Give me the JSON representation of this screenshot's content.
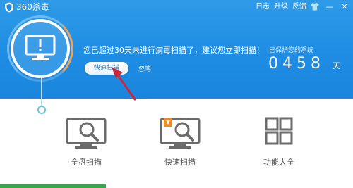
{
  "app": {
    "title": "360杀毒"
  },
  "top_links": [
    "日志",
    "升级",
    "反馈"
  ],
  "window_controls": {
    "shirt": "👕",
    "minimize": "—",
    "close": "✕"
  },
  "status": {
    "warning": "您已超过30天未进行病毒扫描了，建议您立即扫描！",
    "quick_scan_button": "快速扫描",
    "ignore": "忽略"
  },
  "protection": {
    "label": "已保护您的系统",
    "days": "0458",
    "unit": "天"
  },
  "tools": [
    {
      "label": "全盘扫描",
      "icon": "full-scan-icon"
    },
    {
      "label": "快速扫描",
      "icon": "quick-scan-icon"
    },
    {
      "label": "功能大全",
      "icon": "all-features-icon"
    }
  ],
  "colors": {
    "brand_blue": "#1e8de3",
    "arrow_red": "#c8283a",
    "timeline_teal": "#6cc6de",
    "bottom_green": "#35a74c",
    "icon_gray": "#6b6b6b"
  }
}
